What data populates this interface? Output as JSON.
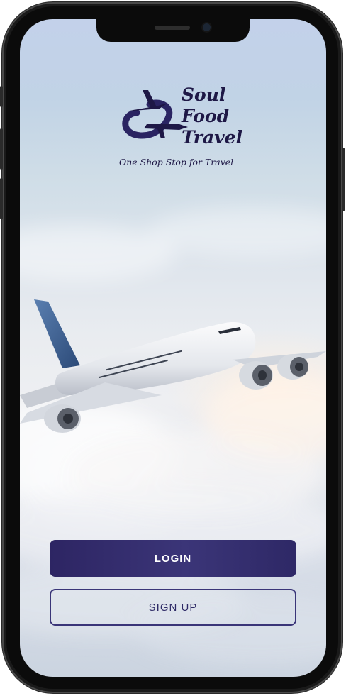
{
  "brand": {
    "line1": "Soul",
    "line2": "Food",
    "line3": "Travel",
    "tagline": "One Shop Stop for Travel",
    "logo_icon": "plane-loop-logo-icon",
    "color": "#1e1846"
  },
  "hero": {
    "image": "airplane-above-clouds"
  },
  "actions": {
    "login_label": "LOGIN",
    "signup_label": "SIGN UP",
    "accent": "#2d2563"
  },
  "device": {
    "frame": "iphone-notch",
    "frame_color": "#1a1a1a"
  }
}
